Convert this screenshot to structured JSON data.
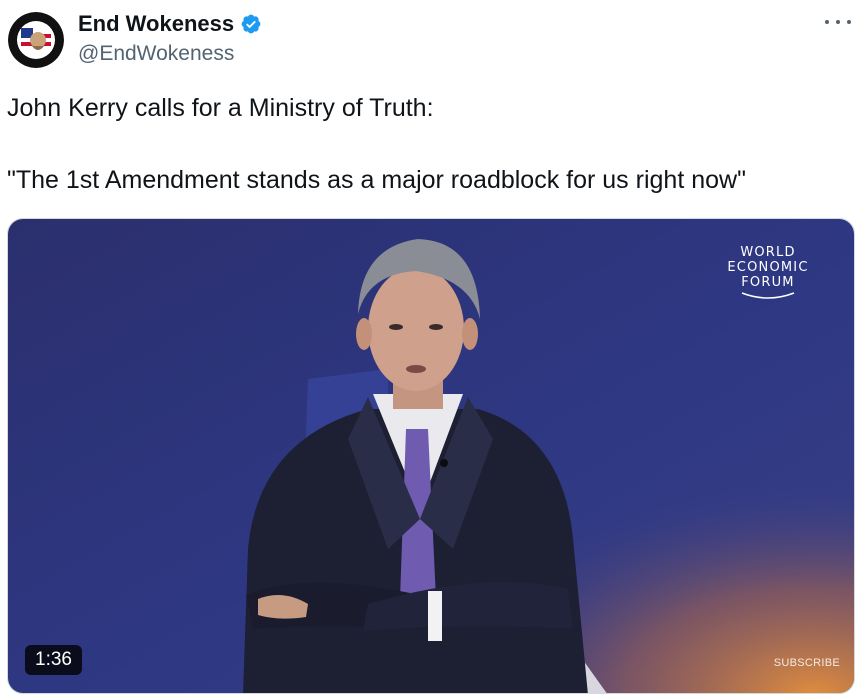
{
  "author": {
    "display_name": "End Wokeness",
    "handle": "@EndWokeness",
    "verified": true,
    "avatar_text_top": "I SUPPORT ALL",
    "avatar_text_bottom": "FORMER THINGS"
  },
  "more_menu": {
    "icon": "more-horizontal-icon"
  },
  "tweet": {
    "line1": "John Kerry calls for a Ministry of Truth:",
    "line2": "\"The 1st Amendment stands as a major roadblock for us right now\""
  },
  "media": {
    "type": "video",
    "duration": "1:36",
    "logo_line1": "WORLD",
    "logo_line2": "ECONOMIC",
    "logo_line3": "FORUM",
    "subscribe_label": "SUBSCRIBE"
  },
  "colors": {
    "verified": "#1d9bf0",
    "text": "#0f1419",
    "secondary": "#536471",
    "video_bg": "#2a3278"
  }
}
